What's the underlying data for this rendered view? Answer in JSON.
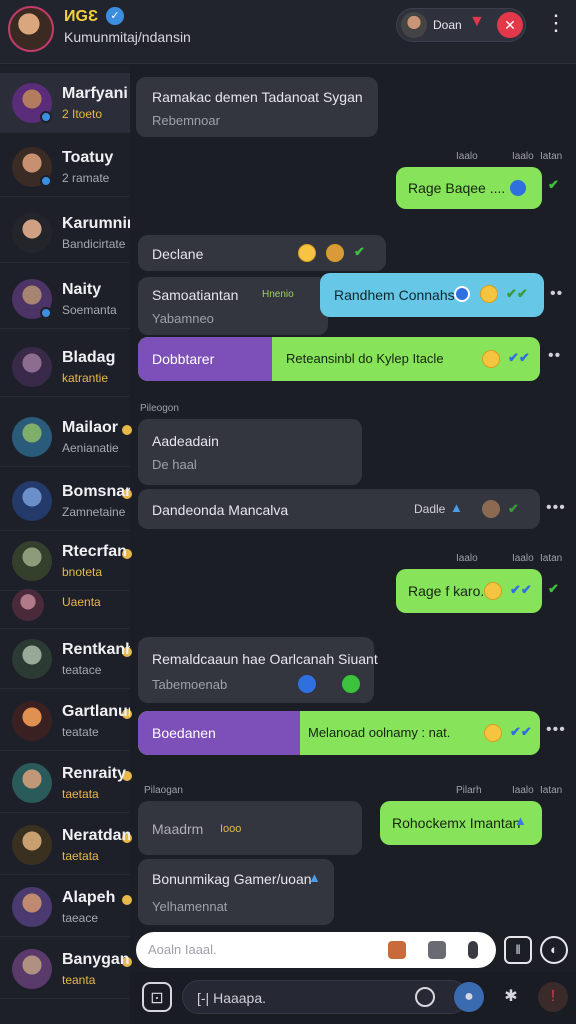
{
  "header": {
    "title": "ИGƐ",
    "subtitle": "Kumunmitaj/ndansin",
    "pill_label": "Doan",
    "colors": {
      "accent": "#e2384a",
      "title": "#f2d23a"
    }
  },
  "sidebar": {
    "items": [
      {
        "name": "Marfyani",
        "sub": "2 Itoeto"
      },
      {
        "name": "Toatuy",
        "sub": "2 ramate"
      },
      {
        "name": "Karumnir",
        "sub": "Bandicirtate"
      },
      {
        "name": "Naity",
        "sub": "Soemanta"
      },
      {
        "name": "Bladag",
        "sub": "katrantie"
      },
      {
        "name": "Mailaor",
        "sub": "Aenianatie"
      },
      {
        "name": "Bomsnar",
        "sub": "Zamnetaine"
      },
      {
        "name": "Rtecrfan",
        "sub": "bnoteta"
      },
      {
        "name": "",
        "sub": "Uaenta"
      },
      {
        "name": "Rentkanh",
        "sub": "teatace"
      },
      {
        "name": "Gartlanur",
        "sub": "teatate"
      },
      {
        "name": "Renraity",
        "sub": "taetata"
      },
      {
        "name": "Neratdan",
        "sub": "taetata"
      },
      {
        "name": "Alapeh",
        "sub": "taeace"
      },
      {
        "name": "Banygan",
        "sub": "teanta"
      }
    ]
  },
  "chat": {
    "m1": {
      "text": "Ramakac demen Tadanoat Sygan",
      "sub": "Rebemnoar"
    },
    "meta1": {
      "a": "Iaalo",
      "b": "Iaalo",
      "c": "Iatan"
    },
    "m2": {
      "text": "Rage Baqee ...."
    },
    "m3": {
      "text": "Declane"
    },
    "m4": {
      "text": "Samoatiantan",
      "tag": "Hnenio",
      "sub": "Yabamneo"
    },
    "m5": {
      "text": "Randhem Connahs"
    },
    "m6": {
      "purple": "Dobbtarer",
      "text": "Reteansinbl do Kylep Itacle"
    },
    "divider1": "Pileogon",
    "m7": {
      "text": "Aadeadain",
      "sub": "De haal"
    },
    "m8": {
      "text": "Dandeonda Mancalva",
      "tag": "Dadle"
    },
    "meta2": {
      "a": "Iaalo",
      "b": "Iaalo",
      "c": "Iatan"
    },
    "m9": {
      "text": "Rage f karo."
    },
    "m10": {
      "text": "Remaldcaaun hae Oarlcanah Siuant",
      "sub": "Tabemoenab"
    },
    "m11": {
      "purple": "Boedanen",
      "text": "Melanoad  oolnamy  : nat."
    },
    "divider2": "Pilaogan",
    "meta3": {
      "a": "Pilarh",
      "b": "Iaalo",
      "c": "Iatan"
    },
    "m12": {
      "text": "Rohockemx Imantan"
    },
    "m13": {
      "text": "Maadrm",
      "tag": "Iooo"
    },
    "m14": {
      "text": "Bonunmikag Gamer/uoan",
      "sub": "Yelhamennat"
    }
  },
  "input": {
    "placeholder": "Aoaln Iaaal."
  },
  "bottom_bar": {
    "field_text": "[-| Haaapa."
  }
}
